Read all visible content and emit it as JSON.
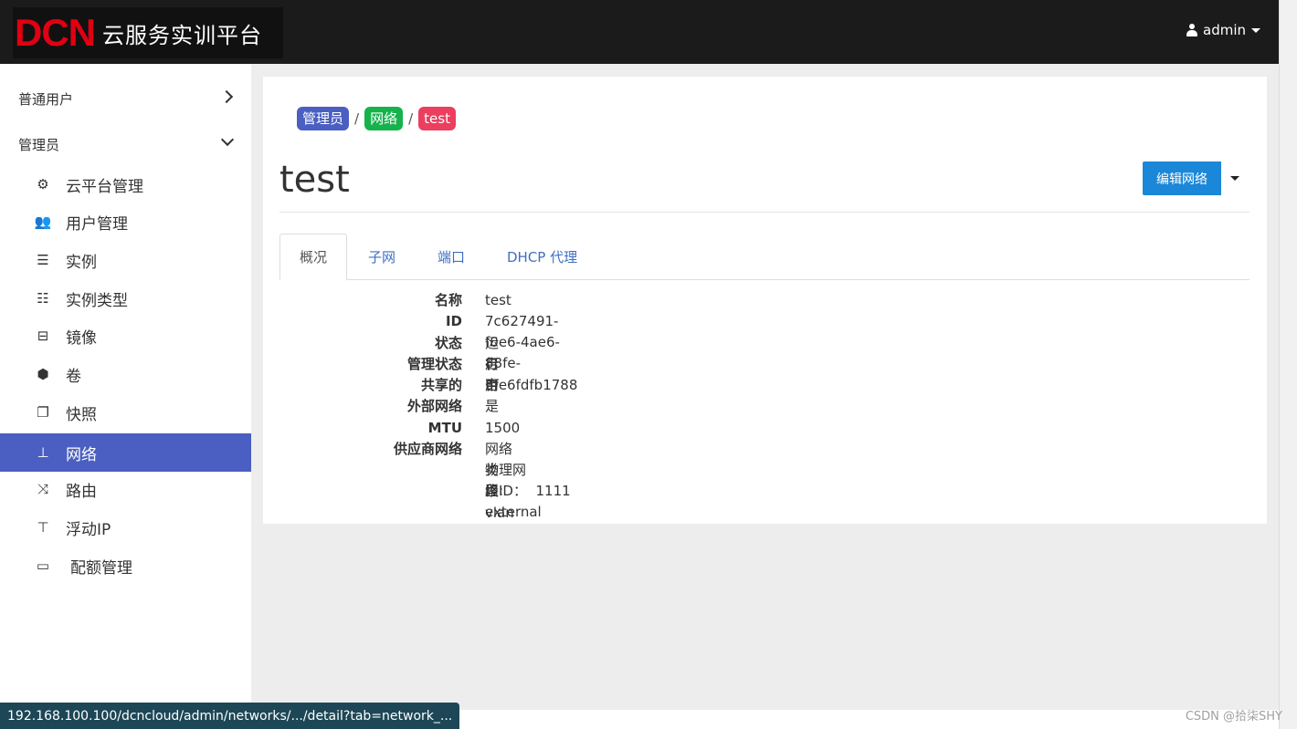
{
  "header": {
    "logo_mark": "DCN",
    "logo_text": "云服务实训平台",
    "user": "admin"
  },
  "sidebar": {
    "panels": [
      {
        "label": "普通用户",
        "expanded": false
      },
      {
        "label": "管理员",
        "expanded": true
      }
    ],
    "items": [
      {
        "label": "云平台管理",
        "icon": "gears-icon",
        "glyph": "⚙"
      },
      {
        "label": "用户管理",
        "icon": "users-icon",
        "glyph": "👥"
      },
      {
        "label": "实例",
        "icon": "server-icon",
        "glyph": "☰"
      },
      {
        "label": "实例类型",
        "icon": "list-icon",
        "glyph": "☷"
      },
      {
        "label": "镜像",
        "icon": "briefcase-icon",
        "glyph": "⊟"
      },
      {
        "label": "卷",
        "icon": "cube-icon",
        "glyph": "⬢"
      },
      {
        "label": "快照",
        "icon": "clone-icon",
        "glyph": "❐"
      },
      {
        "label": "网络",
        "icon": "sitemap-icon",
        "glyph": "⊥",
        "active": true
      },
      {
        "label": "路由",
        "icon": "random-icon",
        "glyph": "⤨"
      },
      {
        "label": "浮动IP",
        "icon": "signpost-icon",
        "glyph": "⊤"
      },
      {
        "label": "配额管理",
        "icon": "battery-icon",
        "glyph": "▭"
      }
    ],
    "active_color": "#4a5fc1"
  },
  "breadcrumb": [
    "管理员",
    "网络",
    "test"
  ],
  "breadcrumb_sep": "/",
  "page": {
    "title": "test",
    "edit_button": "编辑网络"
  },
  "tabs": [
    "概况",
    "子网",
    "端口",
    "DHCP 代理"
  ],
  "details": {
    "labels": [
      "名称",
      "ID",
      "状态",
      "管理状态",
      "共享的",
      "外部网络",
      "MTU",
      "供应商网络"
    ],
    "values": [
      "test",
      "7c627491-f0e6-4ae6-88fe-3fe6fdfb1788",
      "运行中",
      "启用",
      "否",
      "是",
      "1500",
      "网络类型: vlan",
      "物理网络: external",
      "段ID：  1111"
    ]
  },
  "statusbar": "192.168.100.100/dcncloud/admin/networks/.../detail?tab=network_...",
  "watermark": "CSDN @拾柒SHY",
  "colors": {
    "topbar": "#1b1b1b",
    "primary_button": "#1b87d8",
    "crumb_admin": "#4a5fc1",
    "crumb_network": "#16b24c",
    "crumb_current": "#ec3e5f"
  }
}
